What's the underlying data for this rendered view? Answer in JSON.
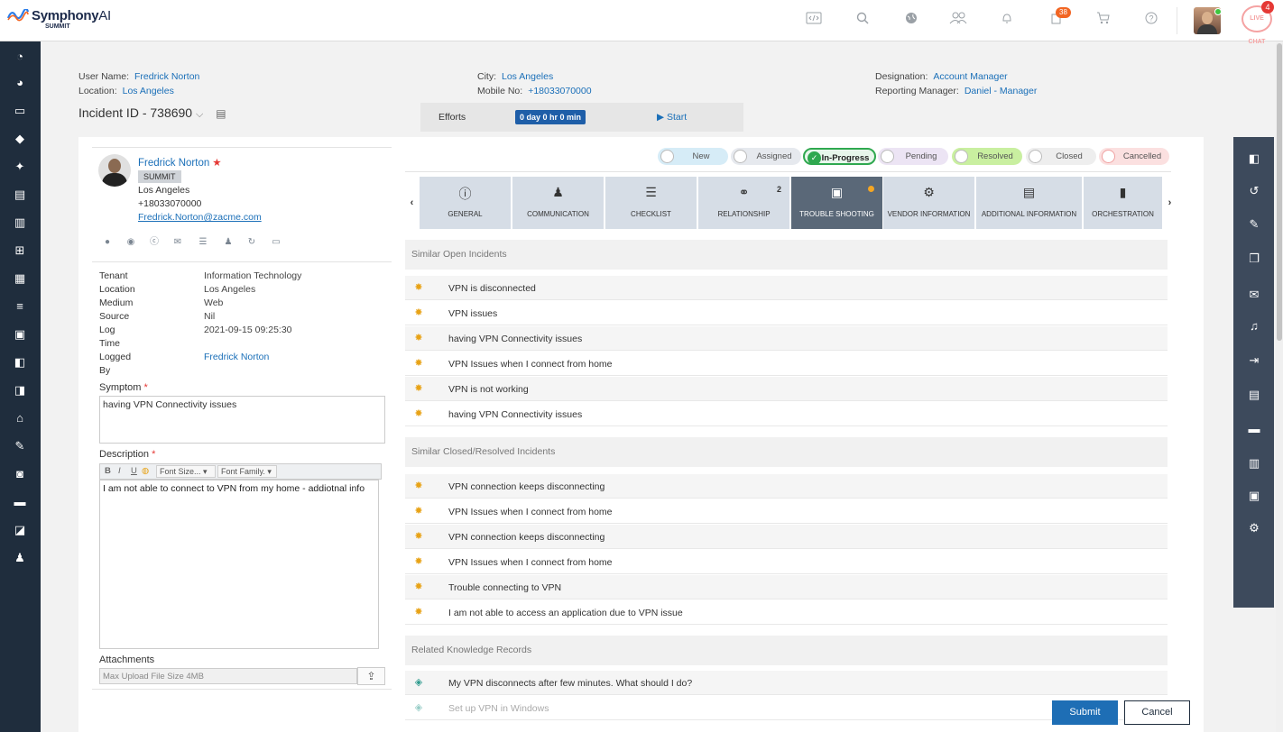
{
  "brand": {
    "name": "Symphony",
    "name_ai": "AI",
    "sub": "SUMMIT"
  },
  "topbar": {
    "icons": [
      "code-icon",
      "search-icon",
      "globe-icon",
      "users-icon",
      "bell-icon",
      "tasks-icon",
      "cart-icon",
      "help-icon"
    ],
    "tasks_badge": "38",
    "chat_label": "LIVE CHAT",
    "chat_badge": "4"
  },
  "header": {
    "user_name_label": "User Name:",
    "user_name": "Fredrick Norton",
    "location_label": "Location:",
    "location": "Los Angeles",
    "city_label": "City:",
    "city": "Los Angeles",
    "mobile_label": "Mobile No:",
    "mobile": "+18033070000",
    "designation_label": "Designation:",
    "designation": "Account Manager",
    "reporting_label": "Reporting Manager:",
    "reporting": "Daniel - Manager",
    "incident_id": "Incident ID - 738690",
    "efforts_label": "Efforts",
    "efforts_time": "0 day 0 hr 0 min",
    "start_label": "Start"
  },
  "user": {
    "name": "Fredrick Norton",
    "org": "SUMMIT",
    "city": "Los Angeles",
    "phone": "+18033070000",
    "email": "Fredrick.Norton@zacme.com"
  },
  "details": [
    {
      "k": "Tenant",
      "v": "Information Technology"
    },
    {
      "k": "Location",
      "v": "Los Angeles"
    },
    {
      "k": "Medium",
      "v": "Web"
    },
    {
      "k": "Source",
      "v": "Nil"
    },
    {
      "k": "Log",
      "v": "2021-09-15 09:25:30"
    },
    {
      "k": "Time",
      "v": ""
    },
    {
      "k": "Logged",
      "v": "Fredrick Norton"
    },
    {
      "k": "By",
      "v": ""
    }
  ],
  "form": {
    "symptom_label": "Symptom",
    "symptom": "having VPN Connectivity issues",
    "description_label": "Description",
    "description": "I am not able to connect to VPN from my home - addiotnal info",
    "font_size": "Font Size...",
    "font_family": "Font Family.",
    "attachments_label": "Attachments",
    "attach_placeholder": "Max Upload File Size 4MB",
    "required_mark": "*"
  },
  "statuses": [
    {
      "label": "New",
      "color": "#d6ecf7",
      "active": false
    },
    {
      "label": "Assigned",
      "color": "#e6e9ee",
      "active": false
    },
    {
      "label": "In-Progress",
      "color": "#e7f6eb",
      "active": true
    },
    {
      "label": "Pending",
      "color": "#ece4f4",
      "active": false
    },
    {
      "label": "Resolved",
      "color": "#c9efa0",
      "active": false
    },
    {
      "label": "Closed",
      "color": "#eeeeee",
      "active": false
    },
    {
      "label": "Cancelled",
      "color": "#fbe0e0",
      "active": false
    }
  ],
  "tabs": [
    {
      "label": "GENERAL",
      "icon": "info-icon",
      "glyph": "ⓘ"
    },
    {
      "label": "COMMUNICATION",
      "icon": "person-icon",
      "glyph": "👤"
    },
    {
      "label": "CHECKLIST",
      "icon": "checklist-icon",
      "glyph": "☰"
    },
    {
      "label": "RELATIONSHIP",
      "icon": "link-icon",
      "glyph": "⚭",
      "count": "2"
    },
    {
      "label": "TROUBLE SHOOTING",
      "icon": "monitor-icon",
      "glyph": "🖥",
      "active": true
    },
    {
      "label": "VENDOR INFORMATION",
      "icon": "vendor-icon",
      "glyph": "⚙"
    },
    {
      "label": "ADDITIONAL INFORMATION",
      "icon": "document-icon",
      "glyph": "📄"
    },
    {
      "label": "ORCHESTRATION",
      "icon": "book-icon",
      "glyph": "📘"
    }
  ],
  "similar_open": {
    "title": "Similar Open Incidents",
    "items": [
      "VPN is disconnected",
      "VPN issues",
      "having VPN Connectivity issues",
      "VPN Issues when I connect from home",
      "VPN is not working",
      "having VPN Connectivity issues"
    ]
  },
  "similar_closed": {
    "title": "Similar Closed/Resolved Incidents",
    "items": [
      "VPN connection keeps disconnecting",
      "VPN Issues when I connect from home",
      "VPN connection keeps disconnecting",
      "VPN Issues when I connect from home",
      "Trouble connecting to VPN",
      "I am not able to access an application due to VPN issue"
    ]
  },
  "knowledge": {
    "title": "Related Knowledge Records",
    "items": [
      "My VPN disconnects after few minutes. What should I do?",
      "Set up VPN in Windows"
    ]
  },
  "actions": {
    "submit": "Submit",
    "cancel": "Cancel"
  }
}
